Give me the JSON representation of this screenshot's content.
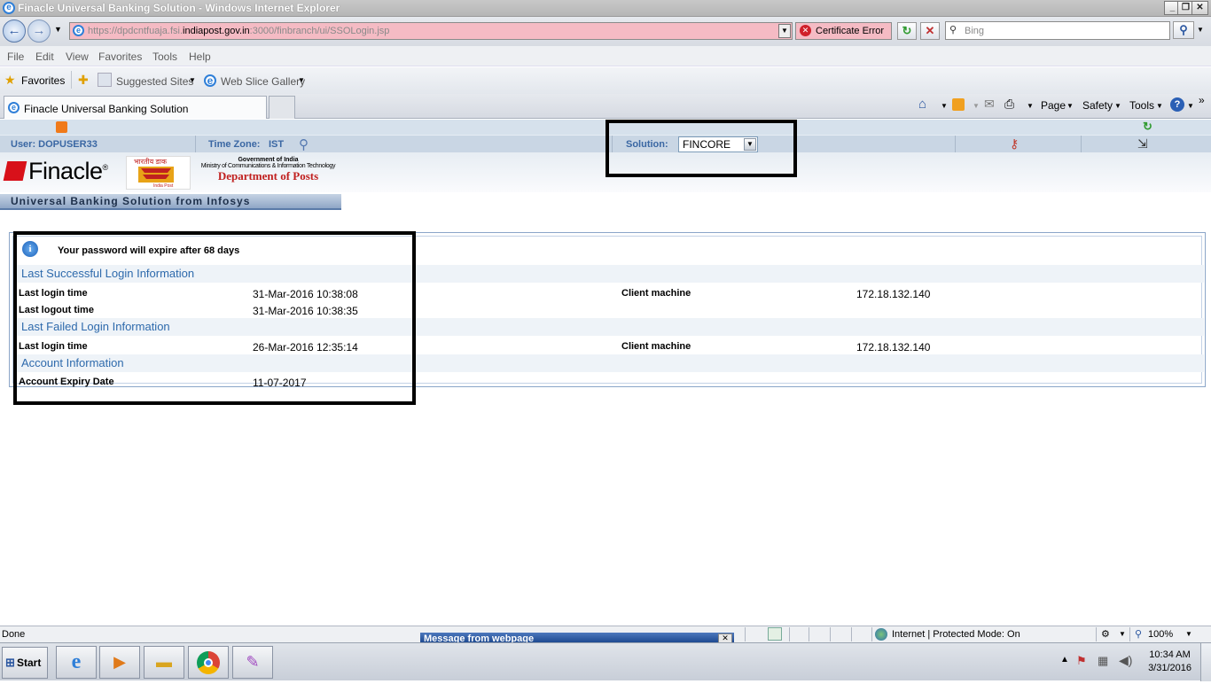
{
  "window": {
    "title": "Finacle Universal Banking Solution - Windows Internet Explorer"
  },
  "navbar": {
    "url_prefix": "https://dpdcntfuaja.fsi.",
    "url_domain": "indiapost.gov.in",
    "url_suffix": ":3000/finbranch/ui/SSOLogin.jsp",
    "cert_error": "Certificate Error",
    "search_placeholder": "Bing"
  },
  "menu": [
    "File",
    "Edit",
    "View",
    "Favorites",
    "Tools",
    "Help"
  ],
  "favorites_bar": {
    "favorites": "Favorites",
    "suggested": "Suggested Sites",
    "web_slice": "Web Slice Gallery"
  },
  "tab": {
    "title": "Finacle Universal Banking Solution"
  },
  "commandbar": {
    "page": "Page",
    "safety": "Safety",
    "tools": "Tools"
  },
  "app": {
    "user": "User: DOPUSER33",
    "timezone_label": "Time Zone:",
    "timezone_value": "IST",
    "solution_label": "Solution:",
    "solution_value": "FINCORE",
    "finacle_logo": "Finacle",
    "gov_line1": "Government of India",
    "gov_line2": "Ministry of Communications & Information Technology",
    "dept": "Department of Posts",
    "dp_logo_top": "भारतीय डाक",
    "dp_logo_bottom": "India Post",
    "banner": "Universal Banking Solution from Infosys"
  },
  "info": {
    "expiry_msg": "Your password will expire after 68 days",
    "last_success_header": "Last Successful Login Information",
    "last_login_label": "Last login time",
    "last_login_value": "31-Mar-2016 10:38:08",
    "client_machine_label": "Client machine",
    "client_machine_value": "172.18.132.140",
    "last_logout_label": "Last logout time",
    "last_logout_value": "31-Mar-2016 10:38:35",
    "last_failed_header": "Last Failed Login Information",
    "failed_login_label": "Last login time",
    "failed_login_value": "26-Mar-2016 12:35:14",
    "failed_client_label": "Client machine",
    "failed_client_value": "172.18.132.140",
    "account_header": "Account Information",
    "account_expiry_label": "Account Expiry Date",
    "account_expiry_value": "11-07-2017"
  },
  "statusbar": {
    "status": "Done",
    "zone": "Internet | Protected Mode: On",
    "zoom": "100%",
    "popup_title": "Message from webpage"
  },
  "taskbar": {
    "start": "Start",
    "time": "10:34 AM",
    "date": "3/31/2016"
  }
}
